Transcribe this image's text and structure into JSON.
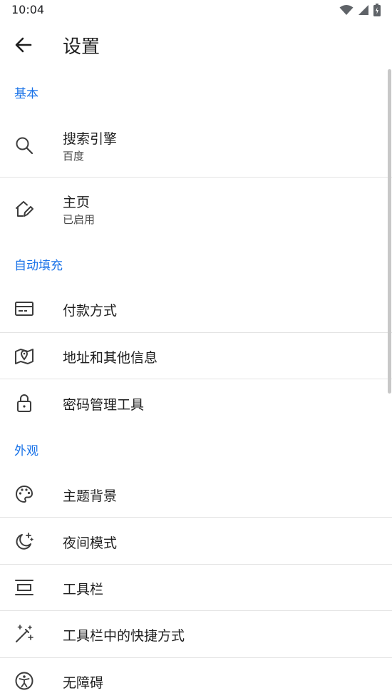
{
  "status_bar": {
    "time": "10:04",
    "icons": [
      "wifi-icon",
      "signal-icon",
      "battery-icon"
    ]
  },
  "app_bar": {
    "title": "设置"
  },
  "sections": {
    "basic": {
      "header": "基本"
    },
    "autofill": {
      "header": "自动填充"
    },
    "appearance": {
      "header": "外观"
    }
  },
  "items": {
    "search_engine": {
      "title": "搜索引擎",
      "subtitle": "百度",
      "icon": "search-icon"
    },
    "homepage": {
      "title": "主页",
      "subtitle": "已启用",
      "icon": "home-edit-icon"
    },
    "payment": {
      "title": "付款方式",
      "icon": "credit-card-icon"
    },
    "address": {
      "title": "地址和其他信息",
      "icon": "map-pin-icon"
    },
    "passwords": {
      "title": "密码管理工具",
      "icon": "lock-icon"
    },
    "theme": {
      "title": "主题背景",
      "icon": "palette-icon"
    },
    "night_mode": {
      "title": "夜间模式",
      "icon": "moon-stars-icon"
    },
    "toolbar": {
      "title": "工具栏",
      "icon": "toolbar-icon"
    },
    "toolbar_shortcut": {
      "title": "工具栏中的快捷方式",
      "icon": "magic-wand-icon"
    },
    "accessibility": {
      "title": "无障碍",
      "icon": "accessibility-icon"
    }
  },
  "colors": {
    "accent": "#1a73e8",
    "divider": "#e3e3e3",
    "text": "#1f1f1f"
  }
}
